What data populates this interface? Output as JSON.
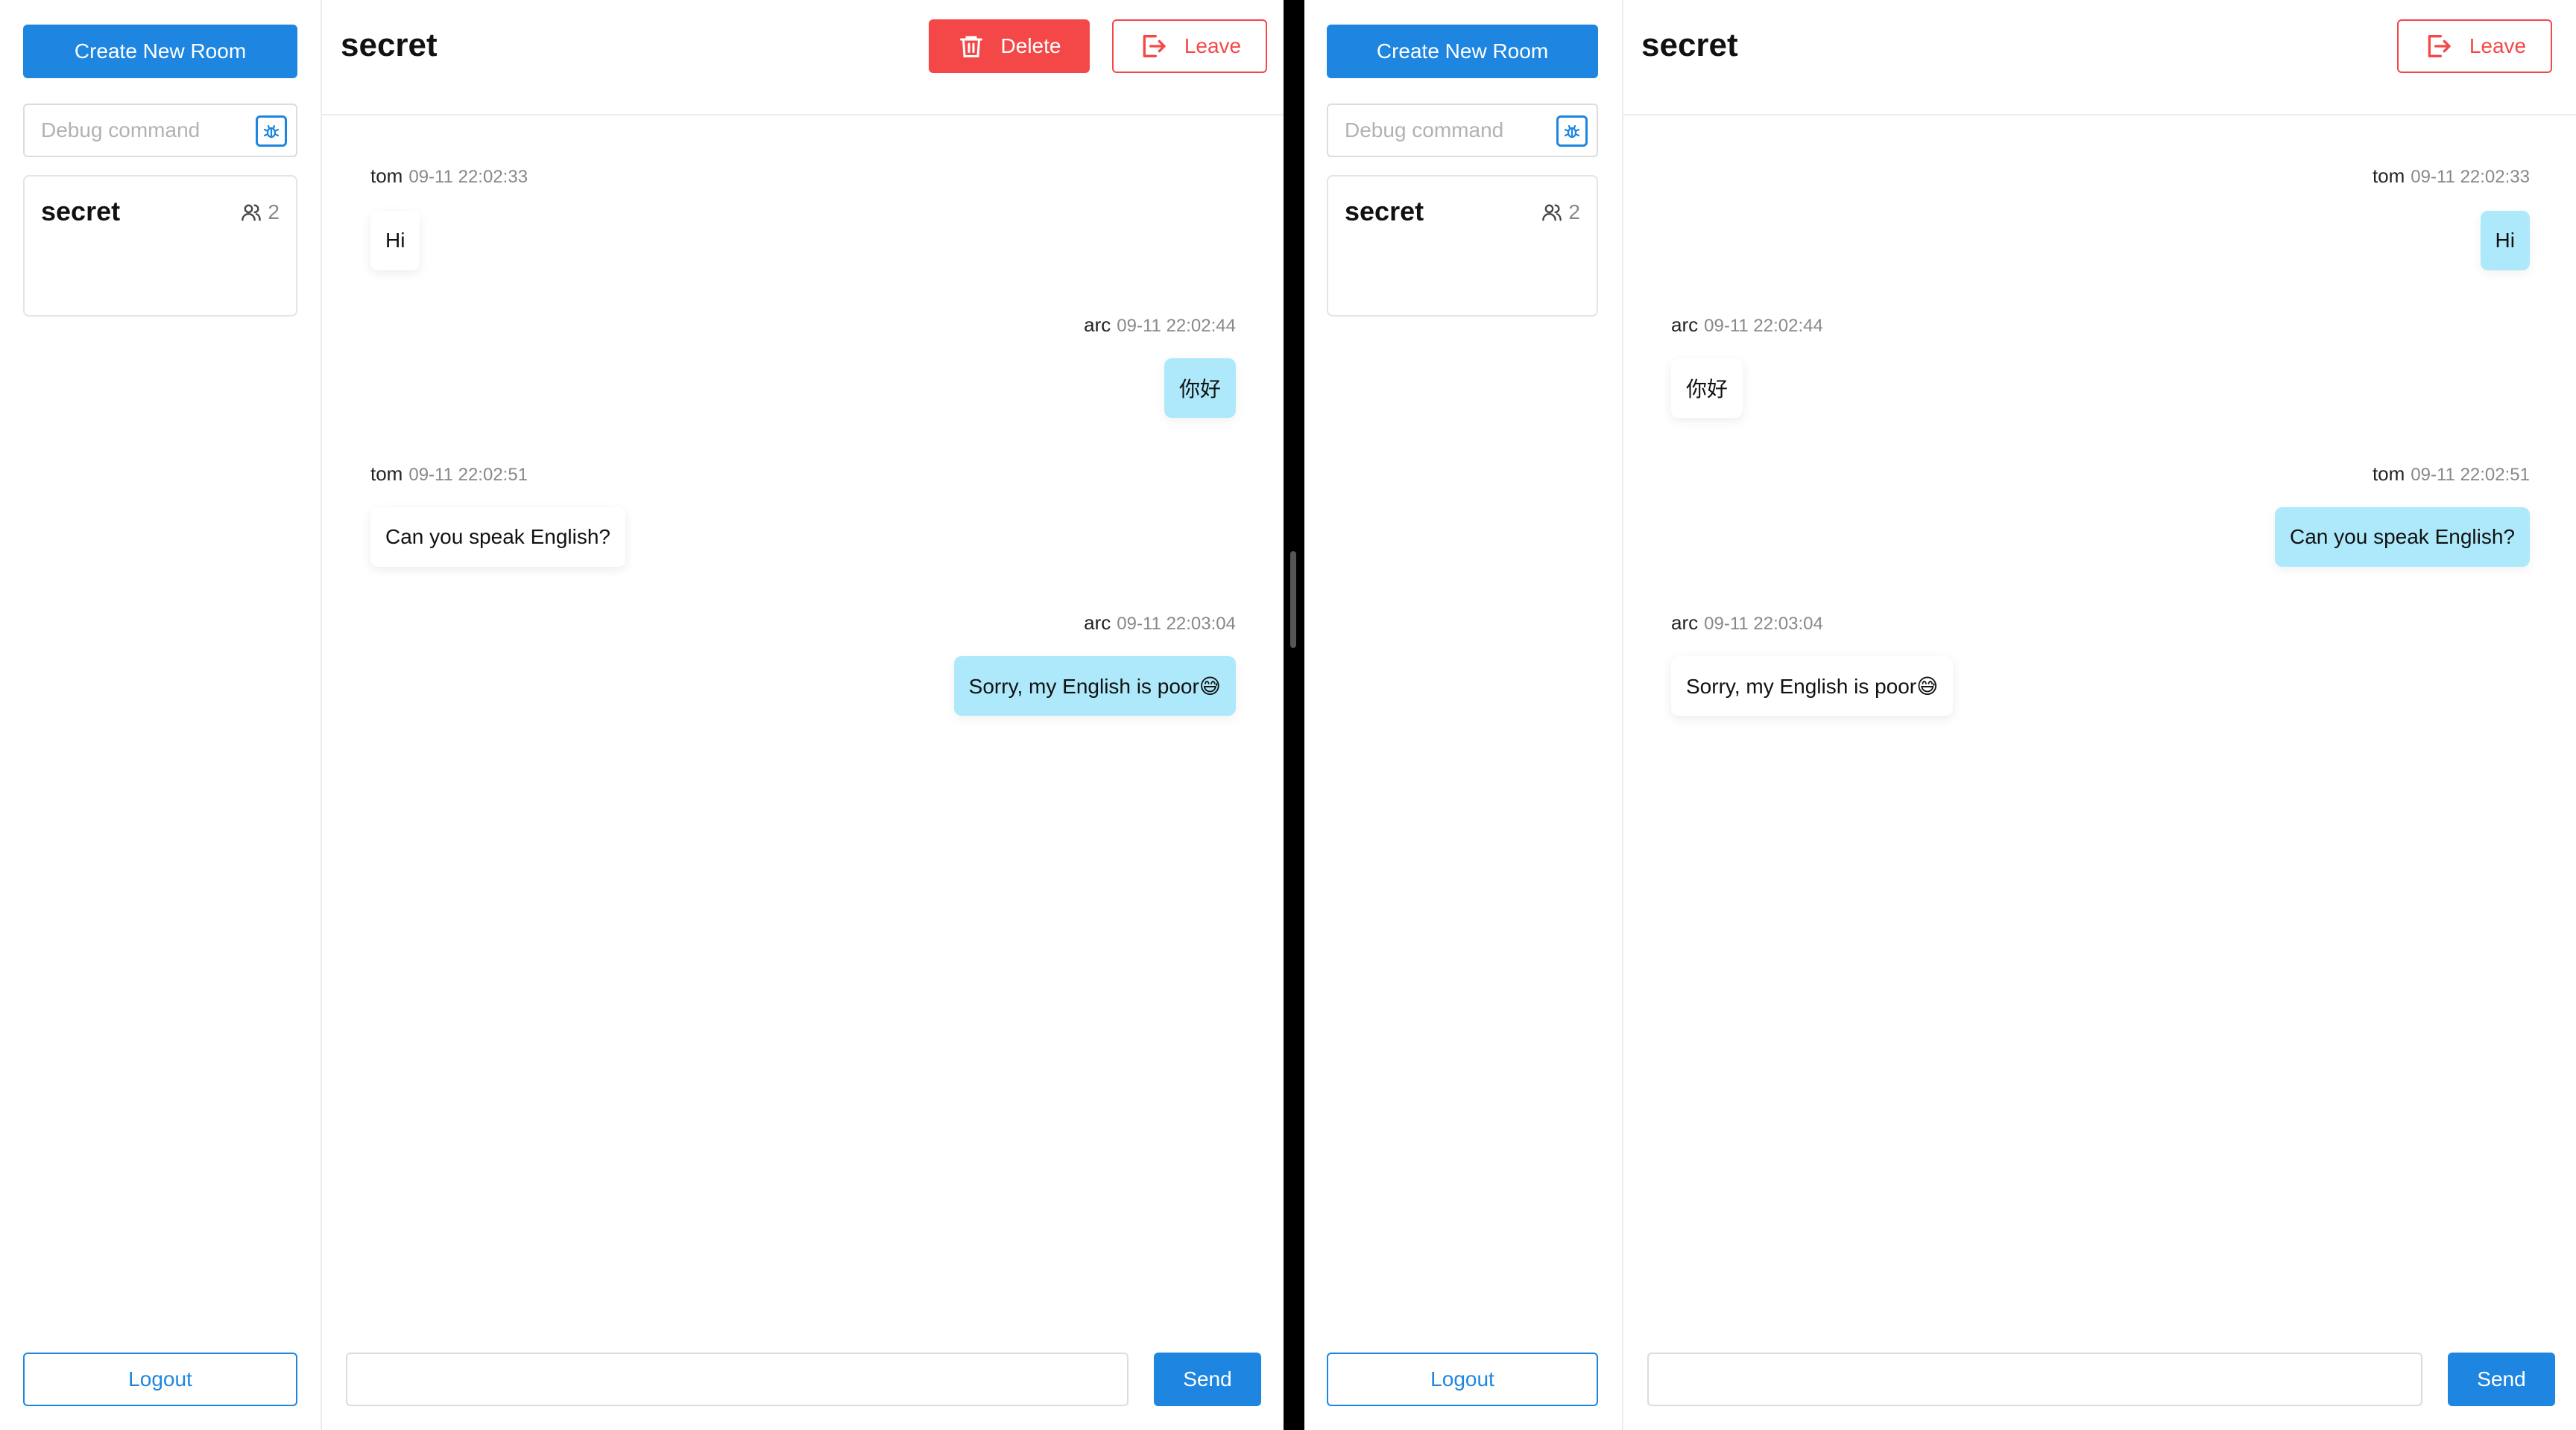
{
  "colors": {
    "primary": "#1e86e0",
    "danger": "#f44848",
    "bubble_self": "#aee9fb",
    "bubble_other": "#ffffff",
    "divider": "#000000"
  },
  "left_window": {
    "sidebar": {
      "create_room_label": "Create New Room",
      "debug_placeholder": "Debug command",
      "debug_icon": "bug-icon",
      "rooms": [
        {
          "name": "secret",
          "member_count": "2",
          "icon": "users-icon"
        }
      ],
      "logout_label": "Logout"
    },
    "header": {
      "room_title": "secret",
      "delete_label": "Delete",
      "delete_icon": "trash-icon",
      "leave_label": "Leave",
      "leave_icon": "logout-icon"
    },
    "messages": [
      {
        "user": "tom",
        "time": "09-11 22:02:33",
        "text": "Hi",
        "self": false
      },
      {
        "user": "arc",
        "time": "09-11 22:02:44",
        "text": "你好",
        "self": true
      },
      {
        "user": "tom",
        "time": "09-11 22:02:51",
        "text": "Can you speak English?",
        "self": false
      },
      {
        "user": "arc",
        "time": "09-11 22:03:04",
        "text": "Sorry, my English is poor😅",
        "self": true
      }
    ],
    "composer": {
      "input_value": "",
      "send_label": "Send"
    }
  },
  "right_window": {
    "sidebar": {
      "create_room_label": "Create New Room",
      "debug_placeholder": "Debug command",
      "debug_icon": "bug-icon",
      "rooms": [
        {
          "name": "secret",
          "member_count": "2",
          "icon": "users-icon"
        }
      ],
      "logout_label": "Logout"
    },
    "header": {
      "room_title": "secret",
      "leave_label": "Leave",
      "leave_icon": "logout-icon"
    },
    "messages": [
      {
        "user": "tom",
        "time": "09-11 22:02:33",
        "text": "Hi",
        "self": true
      },
      {
        "user": "arc",
        "time": "09-11 22:02:44",
        "text": "你好",
        "self": false
      },
      {
        "user": "tom",
        "time": "09-11 22:02:51",
        "text": "Can you speak English?",
        "self": true
      },
      {
        "user": "arc",
        "time": "09-11 22:03:04",
        "text": "Sorry, my English is poor😅",
        "self": false
      }
    ],
    "composer": {
      "input_value": "",
      "send_label": "Send"
    }
  }
}
